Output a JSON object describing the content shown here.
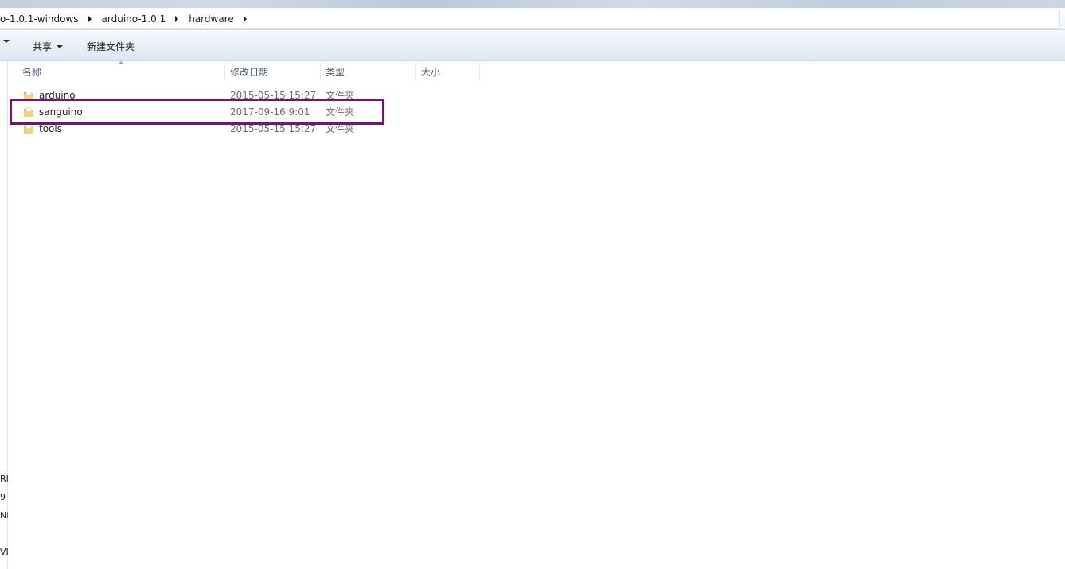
{
  "address": {
    "crumbs": [
      "o-1.0.1-windows",
      "arduino-1.0.1",
      "hardware"
    ]
  },
  "toolbar": {
    "share_label": "共享",
    "new_folder_label": "新建文件夹"
  },
  "columns": {
    "name": "名称",
    "date": "修改日期",
    "type": "类型",
    "size": "大小"
  },
  "files": [
    {
      "name": "arduino",
      "date": "2015-05-15 15:27",
      "type": "文件夹"
    },
    {
      "name": "sanguino",
      "date": "2017-09-16 9:01",
      "type": "文件夹"
    },
    {
      "name": "tools",
      "date": "2015-05-15 15:27",
      "type": "文件夹"
    }
  ],
  "nav_fragments": [
    "RI",
    "9",
    "NF",
    "VD"
  ],
  "colors": {
    "highlight": "#7a1276",
    "folder": "#e8c15a"
  }
}
